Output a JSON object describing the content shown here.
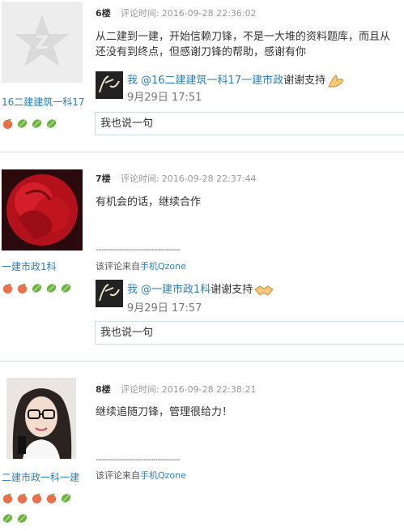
{
  "comments": [
    {
      "floor": "6楼",
      "time_label": "评论时间:",
      "time": "2016-09-28 22:36:02",
      "username": "16二建建筑一科17",
      "content_lines": [
        "从二建到一建，开始信赖刀锋，不是一大堆的资料题库，而且从",
        "还没有到终点，但感谢刀锋的帮助，感谢有你"
      ],
      "badges": [
        "peach",
        "leaf",
        "leaf",
        "leaf"
      ],
      "reply": {
        "me": "我",
        "at": "@16二建建筑一科17一建市政",
        "text": "谢谢支持",
        "emoji": "ok-hand-icon",
        "date": "9月29日 17:51"
      },
      "say": "我也说一句"
    },
    {
      "floor": "7楼",
      "time_label": "评论时间:",
      "time": "2016-09-28 22:37:44",
      "username": "一建市政1科",
      "content_lines": [
        "有机会的话，继续合作"
      ],
      "dashes": "------------------------------",
      "source_prefix": "该评论来自",
      "source_link": "手机Qzone",
      "badges": [
        "peach",
        "peach",
        "leaf",
        "leaf",
        "leaf"
      ],
      "reply": {
        "me": "我",
        "at": "@一建市政1科",
        "text": "谢谢支持",
        "emoji": "handshake-icon",
        "date": "9月29日 17:57"
      },
      "say": "我也说一句"
    },
    {
      "floor": "8楼",
      "time_label": "评论时间:",
      "time": "2016-09-28 22:38:21",
      "username": "二建市政一科一建",
      "content_lines": [
        "继续追随刀锋，管理很给力！"
      ],
      "dashes": "------------------------------",
      "source_prefix": "该评论来自",
      "source_link": "手机Qzone",
      "badges": [
        "peach",
        "peach",
        "peach",
        "peach",
        "leaf",
        "leaf",
        "leaf"
      ]
    }
  ],
  "colors": {
    "link": "#2b7fb8",
    "divider": "#cfe4ee",
    "peach": "#e8704a",
    "leaf": "#6cb33f"
  }
}
